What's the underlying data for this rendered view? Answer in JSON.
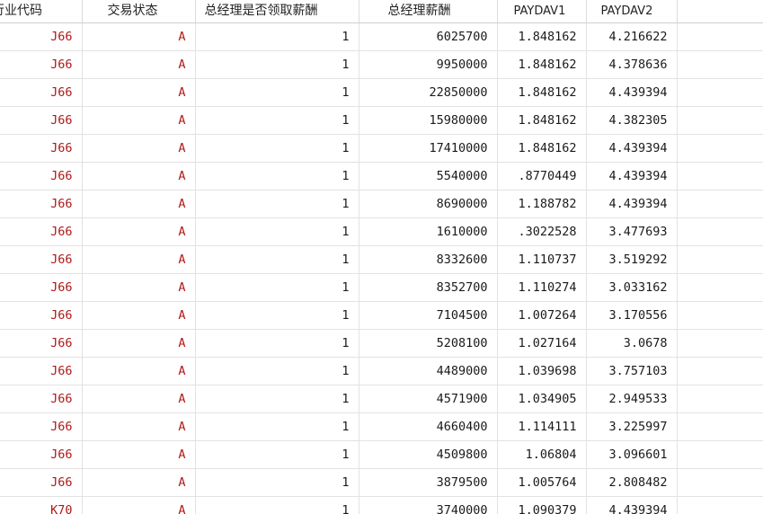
{
  "columns": [
    "行业代码",
    "交易状态",
    "总经理是否领取薪酬",
    "总经理薪酬",
    "PAYDAV1",
    "PAYDAV2",
    ""
  ],
  "rows": [
    [
      "J66",
      "A",
      "1",
      "6025700",
      "1.848162",
      "4.216622"
    ],
    [
      "J66",
      "A",
      "1",
      "9950000",
      "1.848162",
      "4.378636"
    ],
    [
      "J66",
      "A",
      "1",
      "22850000",
      "1.848162",
      "4.439394"
    ],
    [
      "J66",
      "A",
      "1",
      "15980000",
      "1.848162",
      "4.382305"
    ],
    [
      "J66",
      "A",
      "1",
      "17410000",
      "1.848162",
      "4.439394"
    ],
    [
      "J66",
      "A",
      "1",
      "5540000",
      ".8770449",
      "4.439394"
    ],
    [
      "J66",
      "A",
      "1",
      "8690000",
      "1.188782",
      "4.439394"
    ],
    [
      "J66",
      "A",
      "1",
      "1610000",
      ".3022528",
      "3.477693"
    ],
    [
      "J66",
      "A",
      "1",
      "8332600",
      "1.110737",
      "3.519292"
    ],
    [
      "J66",
      "A",
      "1",
      "8352700",
      "1.110274",
      "3.033162"
    ],
    [
      "J66",
      "A",
      "1",
      "7104500",
      "1.007264",
      "3.170556"
    ],
    [
      "J66",
      "A",
      "1",
      "5208100",
      "1.027164",
      "3.0678"
    ],
    [
      "J66",
      "A",
      "1",
      "4489000",
      "1.039698",
      "3.757103"
    ],
    [
      "J66",
      "A",
      "1",
      "4571900",
      "1.034905",
      "2.949533"
    ],
    [
      "J66",
      "A",
      "1",
      "4660400",
      "1.114111",
      "3.225997"
    ],
    [
      "J66",
      "A",
      "1",
      "4509800",
      "1.06804",
      "3.096601"
    ],
    [
      "J66",
      "A",
      "1",
      "3879500",
      "1.005764",
      "2.808482"
    ],
    [
      "K70",
      "A",
      "1",
      "3740000",
      "1.090379",
      "4.439394"
    ]
  ],
  "colors": {
    "string_value": "#b01818",
    "numeric_value": "#1a1a1a",
    "grid_line": "#e2e2e2"
  }
}
